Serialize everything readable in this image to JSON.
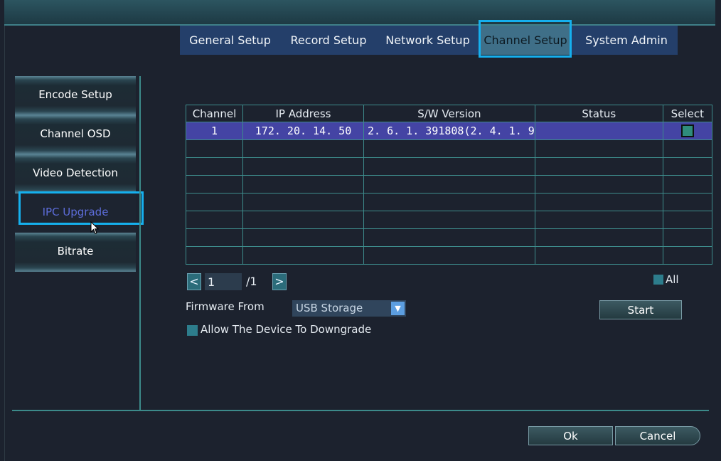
{
  "tabs": [
    {
      "label": "General Setup",
      "active": false
    },
    {
      "label": "Record Setup",
      "active": false
    },
    {
      "label": "Network Setup",
      "active": false
    },
    {
      "label": "Channel Setup",
      "active": true
    },
    {
      "label": "System Admin",
      "active": false
    }
  ],
  "sidebar": {
    "items": [
      {
        "label": "Encode Setup",
        "active": false
      },
      {
        "label": "Channel OSD",
        "active": false
      },
      {
        "label": "Video Detection",
        "active": false
      },
      {
        "label": "IPC Upgrade",
        "active": true
      },
      {
        "label": "Bitrate",
        "active": false
      }
    ]
  },
  "table": {
    "headers": [
      "Channel",
      "IP Address",
      "S/W Version",
      "Status",
      "Select"
    ],
    "rows": [
      {
        "channel": "1",
        "ip": "172. 20. 14. 50",
        "version": "2. 6. 1. 391808(2. 4. 1. 9",
        "status": "",
        "selected": true
      },
      {
        "channel": "",
        "ip": "",
        "version": "",
        "status": "",
        "selected": false
      },
      {
        "channel": "",
        "ip": "",
        "version": "",
        "status": "",
        "selected": false
      },
      {
        "channel": "",
        "ip": "",
        "version": "",
        "status": "",
        "selected": false
      },
      {
        "channel": "",
        "ip": "",
        "version": "",
        "status": "",
        "selected": false
      },
      {
        "channel": "",
        "ip": "",
        "version": "",
        "status": "",
        "selected": false
      },
      {
        "channel": "",
        "ip": "",
        "version": "",
        "status": "",
        "selected": false
      },
      {
        "channel": "",
        "ip": "",
        "version": "",
        "status": "",
        "selected": false
      }
    ]
  },
  "pager": {
    "prev_icon": "chevron-left-icon",
    "next_icon": "chevron-right-icon",
    "prev": "<",
    "next": ">",
    "page": "1",
    "total": "/1"
  },
  "select_all": {
    "label": "All"
  },
  "firmware": {
    "label": "Firmware From",
    "value": "USB Storage"
  },
  "downgrade": {
    "label": "Allow The Device To Downgrade"
  },
  "buttons": {
    "start": "Start",
    "ok": "Ok",
    "cancel": "Cancel"
  },
  "colors": {
    "accent_highlight": "#15b0ee",
    "tab_bar": "#243f6a",
    "selected_row": "#4444a4",
    "checkbox": "#2d7d8c",
    "grid_line": "#3d8c8c"
  }
}
